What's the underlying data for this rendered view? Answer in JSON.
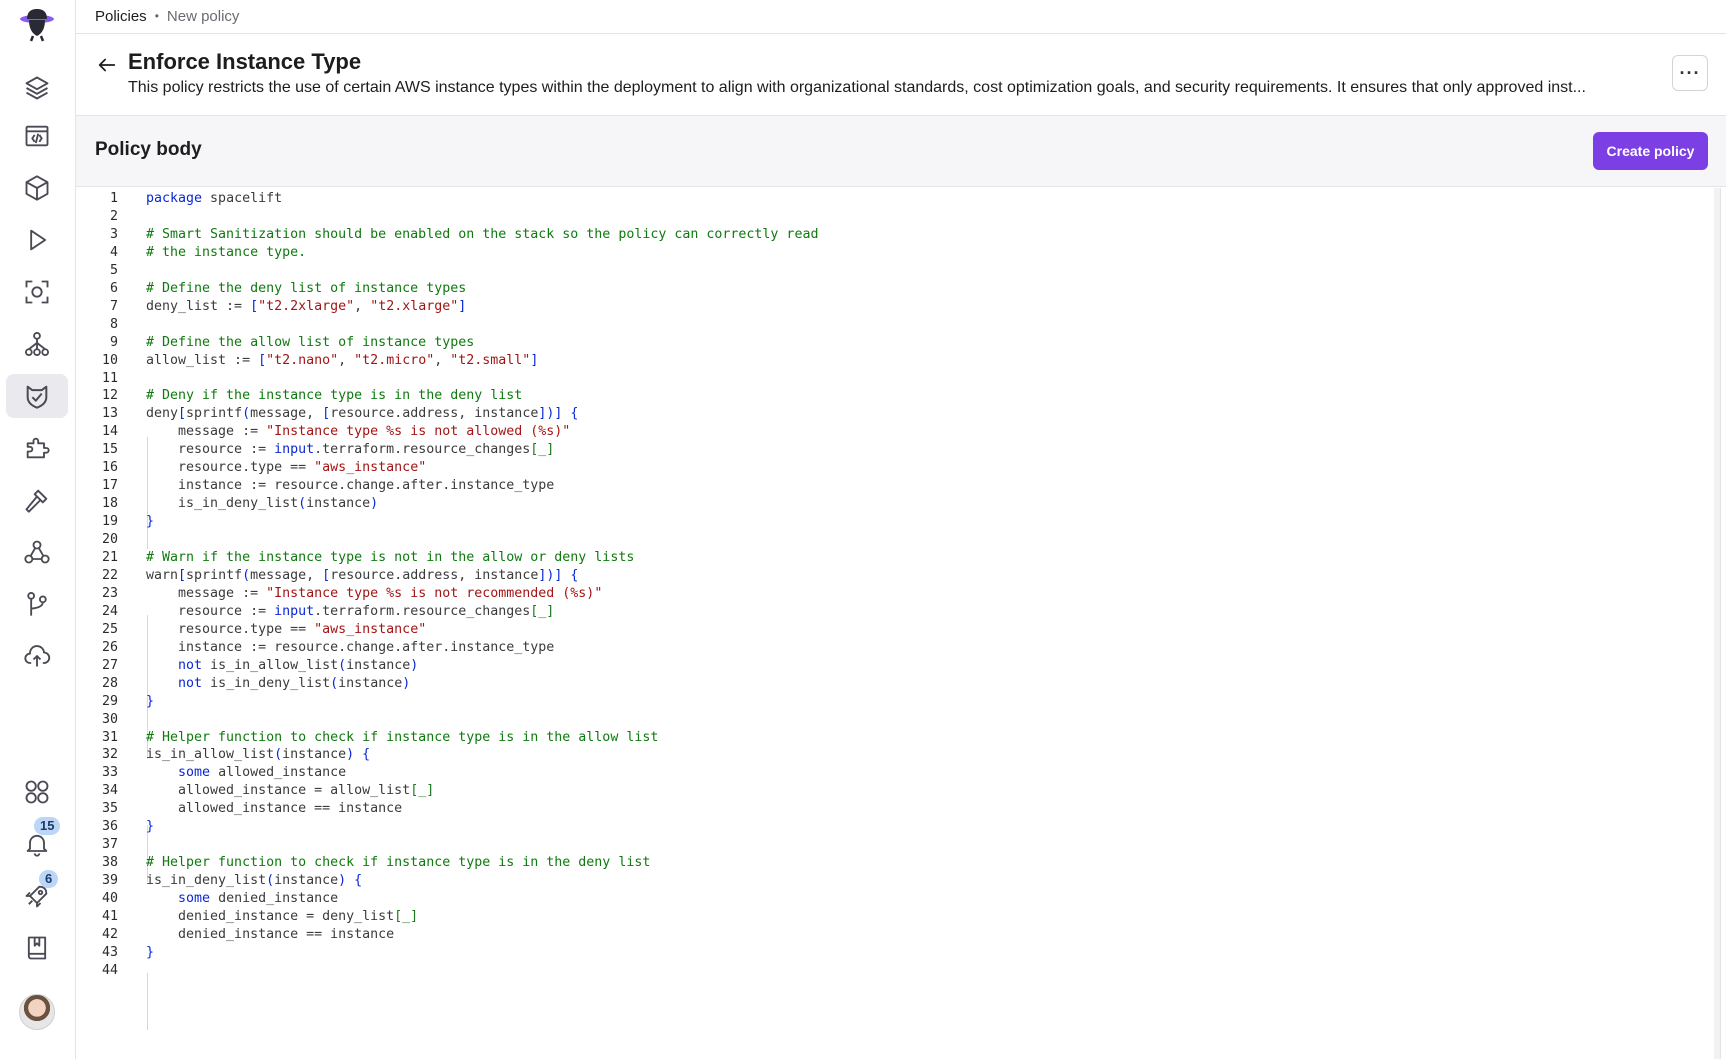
{
  "breadcrumb": {
    "root": "Policies",
    "separator": "•",
    "current": "New policy"
  },
  "header": {
    "title": "Enforce Instance Type",
    "description": "This policy restricts the use of certain AWS instance types within the deployment to align with organizational standards, cost optimization goals, and security requirements. It ensures that only approved inst...",
    "more_label": "···"
  },
  "section": {
    "title": "Policy body",
    "create_label": "Create policy"
  },
  "sidebar": {
    "items": [
      {
        "name": "stacks-icon"
      },
      {
        "name": "blueprints-icon"
      },
      {
        "name": "modules-icon"
      },
      {
        "name": "runs-icon"
      },
      {
        "name": "resources-icon"
      },
      {
        "name": "spaces-icon"
      },
      {
        "name": "policies-icon",
        "active": true
      },
      {
        "name": "integrations-icon"
      },
      {
        "name": "hammer-icon"
      },
      {
        "name": "webhooks-icon"
      },
      {
        "name": "vcs-icon"
      },
      {
        "name": "cloud-upload-icon"
      },
      {
        "name": "apps-icon"
      },
      {
        "name": "notifications-icon"
      },
      {
        "name": "launchpad-icon"
      },
      {
        "name": "docs-icon"
      }
    ],
    "notifications_badge": "15",
    "launchpad_badge": "6"
  },
  "colors": {
    "accent": "#7b3fe4",
    "keyword": "#0a28d6",
    "comment": "#0f7a0f",
    "string": "#a31515"
  },
  "code": {
    "lines": [
      [
        [
          "kw",
          "package"
        ],
        [
          "tx",
          " spacelift"
        ]
      ],
      [],
      [
        [
          "cm",
          "# Smart Sanitization should be enabled on the stack so the policy can correctly read"
        ]
      ],
      [
        [
          "cm",
          "# the instance type."
        ]
      ],
      [],
      [
        [
          "cm",
          "# Define the deny list of instance types"
        ]
      ],
      [
        [
          "tx",
          "deny_list := "
        ],
        [
          "pn",
          "["
        ],
        [
          "st",
          "\"t2.2xlarge\""
        ],
        [
          "tx",
          ", "
        ],
        [
          "st",
          "\"t2.xlarge\""
        ],
        [
          "pn",
          "]"
        ]
      ],
      [],
      [
        [
          "cm",
          "# Define the allow list of instance types"
        ]
      ],
      [
        [
          "tx",
          "allow_list := "
        ],
        [
          "pn",
          "["
        ],
        [
          "st",
          "\"t2.nano\""
        ],
        [
          "tx",
          ", "
        ],
        [
          "st",
          "\"t2.micro\""
        ],
        [
          "tx",
          ", "
        ],
        [
          "st",
          "\"t2.small\""
        ],
        [
          "pn",
          "]"
        ]
      ],
      [],
      [
        [
          "cm",
          "# Deny if the instance type is in the deny list"
        ]
      ],
      [
        [
          "tx",
          "deny"
        ],
        [
          "pn",
          "["
        ],
        [
          "tx",
          "sprintf"
        ],
        [
          "pn",
          "("
        ],
        [
          "tx",
          "message, "
        ],
        [
          "pn",
          "["
        ],
        [
          "tx",
          "resource.address, instance"
        ],
        [
          "pn",
          "])] {"
        ]
      ],
      [
        [
          "tx",
          "    message := "
        ],
        [
          "st",
          "\"Instance type %s is not allowed (%s)\""
        ]
      ],
      [
        [
          "tx",
          "    resource := "
        ],
        [
          "kw",
          "input"
        ],
        [
          "tx",
          ".terraform.resource_changes"
        ],
        [
          "br",
          "[_]"
        ]
      ],
      [
        [
          "tx",
          "    resource.type == "
        ],
        [
          "st",
          "\"aws_instance\""
        ]
      ],
      [
        [
          "tx",
          "    instance := resource.change.after.instance_type"
        ]
      ],
      [
        [
          "tx",
          "    is_in_deny_list"
        ],
        [
          "pn",
          "("
        ],
        [
          "tx",
          "instance"
        ],
        [
          "pn",
          ")"
        ]
      ],
      [
        [
          "pn",
          "}"
        ]
      ],
      [],
      [
        [
          "cm",
          "# Warn if the instance type is not in the allow or deny lists"
        ]
      ],
      [
        [
          "tx",
          "warn"
        ],
        [
          "pn",
          "["
        ],
        [
          "tx",
          "sprintf"
        ],
        [
          "pn",
          "("
        ],
        [
          "tx",
          "message, "
        ],
        [
          "pn",
          "["
        ],
        [
          "tx",
          "resource.address, instance"
        ],
        [
          "pn",
          "])] {"
        ]
      ],
      [
        [
          "tx",
          "    message := "
        ],
        [
          "st",
          "\"Instance type %s is not recommended (%s)\""
        ]
      ],
      [
        [
          "tx",
          "    resource := "
        ],
        [
          "kw",
          "input"
        ],
        [
          "tx",
          ".terraform.resource_changes"
        ],
        [
          "br",
          "[_]"
        ]
      ],
      [
        [
          "tx",
          "    resource.type == "
        ],
        [
          "st",
          "\"aws_instance\""
        ]
      ],
      [
        [
          "tx",
          "    instance := resource.change.after.instance_type"
        ]
      ],
      [
        [
          "tx",
          "    "
        ],
        [
          "kw",
          "not"
        ],
        [
          "tx",
          " is_in_allow_list"
        ],
        [
          "pn",
          "("
        ],
        [
          "tx",
          "instance"
        ],
        [
          "pn",
          ")"
        ]
      ],
      [
        [
          "tx",
          "    "
        ],
        [
          "kw",
          "not"
        ],
        [
          "tx",
          " is_in_deny_list"
        ],
        [
          "pn",
          "("
        ],
        [
          "tx",
          "instance"
        ],
        [
          "pn",
          ")"
        ]
      ],
      [
        [
          "pn",
          "}"
        ]
      ],
      [],
      [
        [
          "cm",
          "# Helper function to check if instance type is in the allow list"
        ]
      ],
      [
        [
          "tx",
          "is_in_allow_list"
        ],
        [
          "pn",
          "("
        ],
        [
          "tx",
          "instance"
        ],
        [
          "pn",
          ") {"
        ]
      ],
      [
        [
          "tx",
          "    "
        ],
        [
          "kw",
          "some"
        ],
        [
          "tx",
          " allowed_instance"
        ]
      ],
      [
        [
          "tx",
          "    allowed_instance = allow_list"
        ],
        [
          "br",
          "[_]"
        ]
      ],
      [
        [
          "tx",
          "    allowed_instance == instance"
        ]
      ],
      [
        [
          "pn",
          "}"
        ]
      ],
      [],
      [
        [
          "cm",
          "# Helper function to check if instance type is in the deny list"
        ]
      ],
      [
        [
          "tx",
          "is_in_deny_list"
        ],
        [
          "pn",
          "("
        ],
        [
          "tx",
          "instance"
        ],
        [
          "pn",
          ") {"
        ]
      ],
      [
        [
          "tx",
          "    "
        ],
        [
          "kw",
          "some"
        ],
        [
          "tx",
          " denied_instance"
        ]
      ],
      [
        [
          "tx",
          "    denied_instance = deny_list"
        ],
        [
          "br",
          "[_]"
        ]
      ],
      [
        [
          "tx",
          "    denied_instance == instance"
        ]
      ],
      [
        [
          "pn",
          "}"
        ]
      ],
      []
    ]
  }
}
